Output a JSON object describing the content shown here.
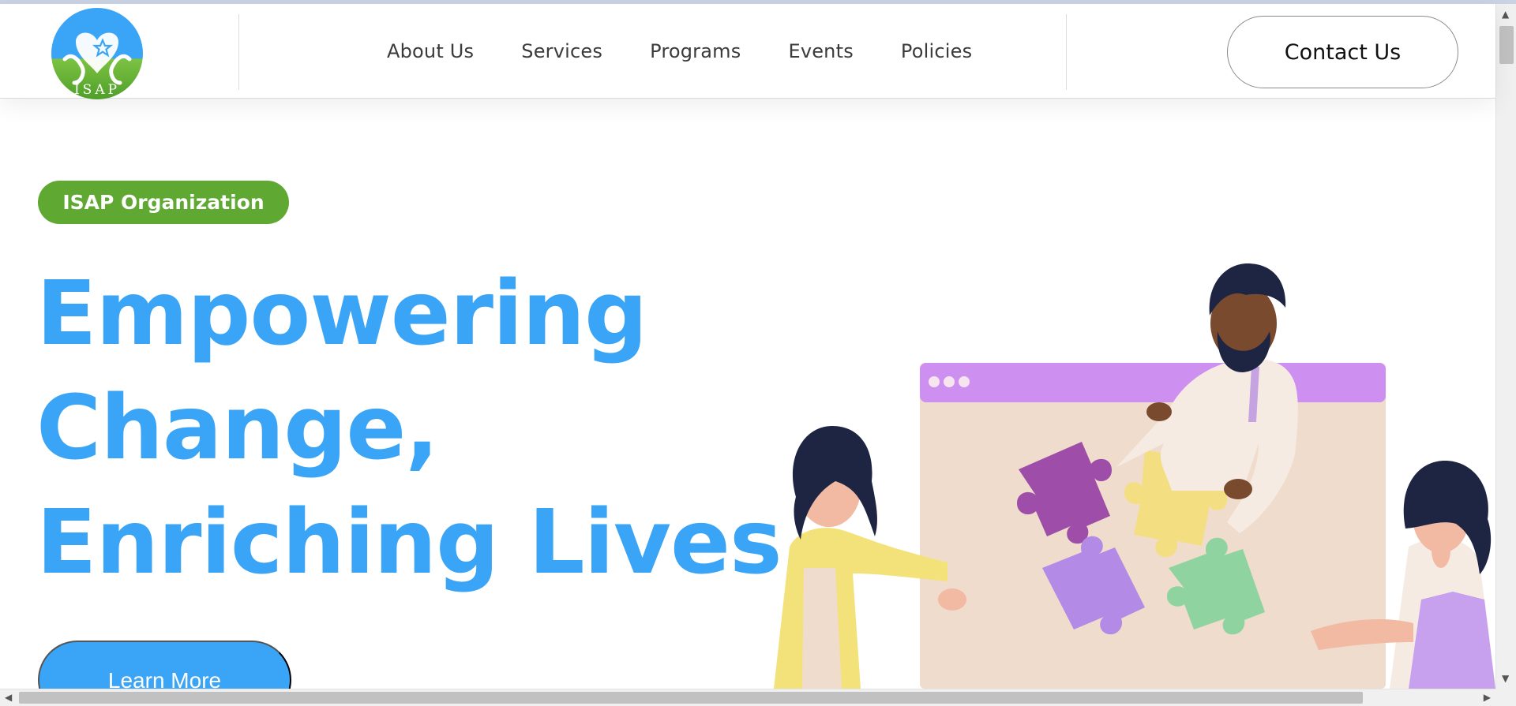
{
  "header": {
    "logo_text": "ISAP",
    "nav": [
      {
        "label": "About Us"
      },
      {
        "label": "Services"
      },
      {
        "label": "Programs"
      },
      {
        "label": "Events"
      },
      {
        "label": "Policies"
      }
    ],
    "contact_label": "Contact Us"
  },
  "hero": {
    "badge": "ISAP Organization",
    "headline_lines": [
      "Empowering",
      "Change,",
      "Enriching Lives"
    ],
    "cta_label": "Learn More"
  },
  "colors": {
    "brand_blue": "#3aa4f6",
    "brand_green": "#5fa832",
    "puzzle_purple": "#9e4ea8",
    "puzzle_yellow": "#f3df82",
    "puzzle_lilac": "#b38ae6",
    "puzzle_green": "#8fd3a0"
  },
  "icons": {
    "logo": "isap-logo-heart-star",
    "scroll_up": "triangle-up-icon",
    "scroll_down": "triangle-down-icon",
    "scroll_left": "triangle-left-icon",
    "scroll_right": "triangle-right-icon"
  }
}
